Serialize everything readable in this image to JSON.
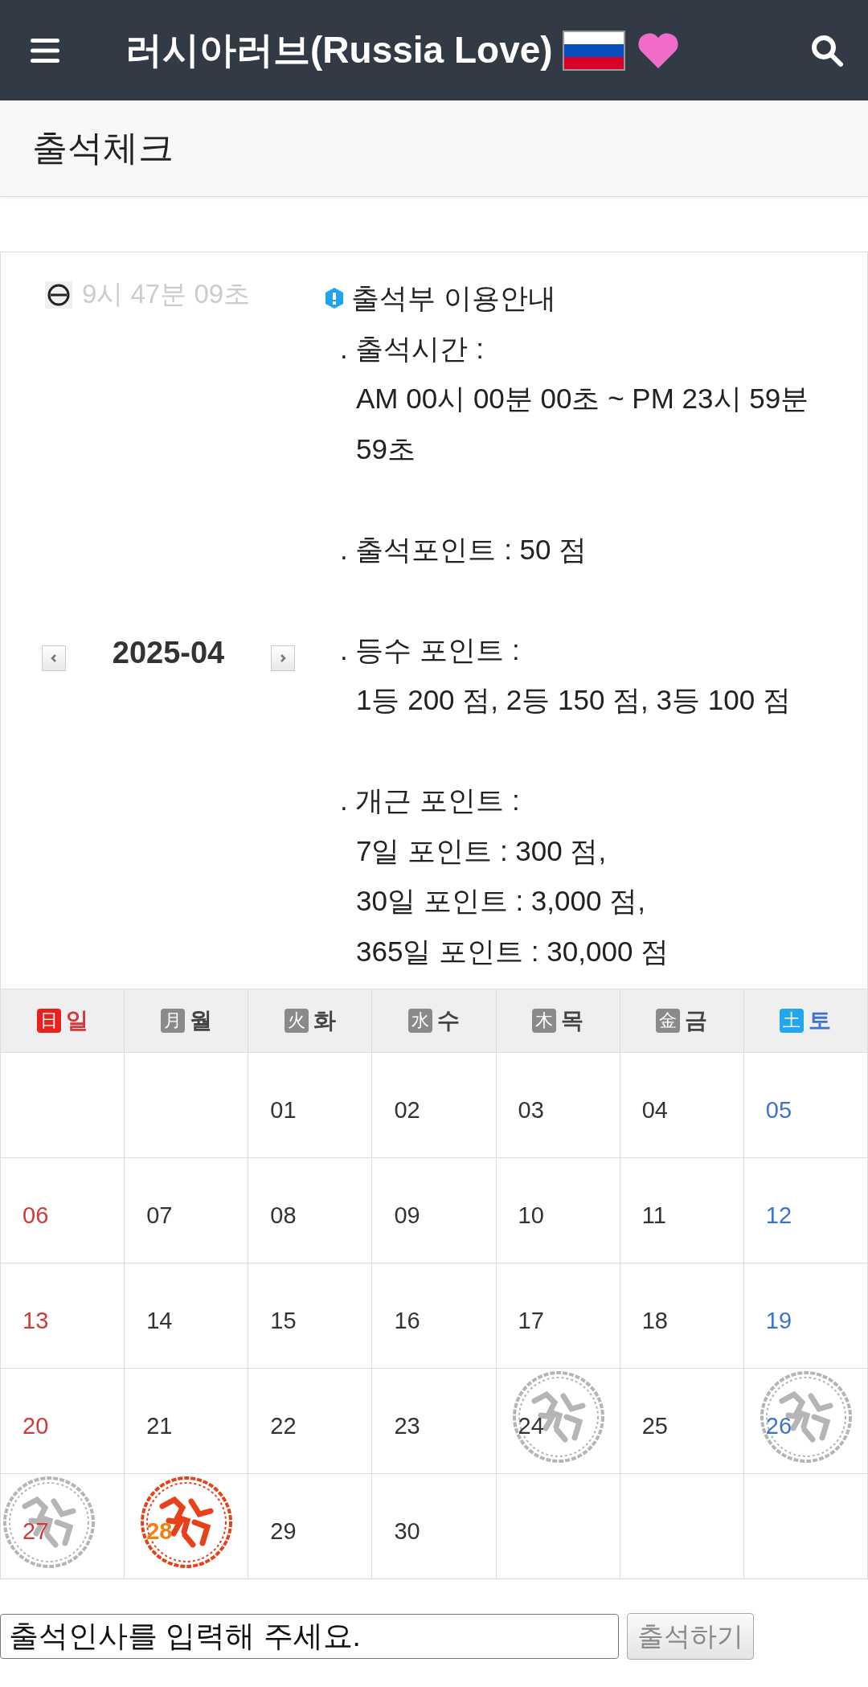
{
  "header": {
    "title": "러시아러브(Russia Love)"
  },
  "page_title": "출석체크",
  "clock": "9시 47분 09초",
  "month": "2025-04",
  "info": {
    "title": "출석부 이용안내",
    "sections": [
      {
        "label": ". 출석시간 :",
        "details": [
          "AM 00시 00분 00초 ~ PM 23시 59분 59초"
        ]
      },
      {
        "label": ". 출석포인트 : 50 점"
      },
      {
        "label": ". 등수 포인트 :",
        "details": [
          "1등 200 점, 2등 150 점, 3등 100 점"
        ]
      },
      {
        "label": ". 개근 포인트 :",
        "details": [
          "7일 포인트 : 300 점,",
          "30일 포인트 : 3,000 점,",
          "365일 포인트 : 30,000 점"
        ]
      }
    ]
  },
  "weekdays": [
    {
      "badge": "日",
      "label": "일",
      "kind": "sunday"
    },
    {
      "badge": "月",
      "label": "월",
      "kind": "weekday"
    },
    {
      "badge": "火",
      "label": "화",
      "kind": "weekday"
    },
    {
      "badge": "水",
      "label": "수",
      "kind": "weekday"
    },
    {
      "badge": "木",
      "label": "목",
      "kind": "weekday"
    },
    {
      "badge": "金",
      "label": "금",
      "kind": "weekday"
    },
    {
      "badge": "土",
      "label": "토",
      "kind": "saturday"
    }
  ],
  "weeks": [
    [
      {
        "kind": "blank"
      },
      {
        "kind": "blank"
      },
      {
        "kind": "day",
        "day": "01",
        "stamped": false,
        "today": false
      },
      {
        "kind": "day",
        "day": "02",
        "stamped": false,
        "today": false
      },
      {
        "kind": "day",
        "day": "03",
        "stamped": false,
        "today": false
      },
      {
        "kind": "day",
        "day": "04",
        "stamped": false,
        "today": false
      },
      {
        "kind": "day",
        "day": "05",
        "stamped": false,
        "today": false
      }
    ],
    [
      {
        "kind": "day",
        "day": "06",
        "stamped": false,
        "today": false
      },
      {
        "kind": "day",
        "day": "07",
        "stamped": false,
        "today": false
      },
      {
        "kind": "day",
        "day": "08",
        "stamped": false,
        "today": false
      },
      {
        "kind": "day",
        "day": "09",
        "stamped": false,
        "today": false
      },
      {
        "kind": "day",
        "day": "10",
        "stamped": false,
        "today": false
      },
      {
        "kind": "day",
        "day": "11",
        "stamped": false,
        "today": false
      },
      {
        "kind": "day",
        "day": "12",
        "stamped": false,
        "today": false
      }
    ],
    [
      {
        "kind": "day",
        "day": "13",
        "stamped": false,
        "today": false
      },
      {
        "kind": "day",
        "day": "14",
        "stamped": false,
        "today": false
      },
      {
        "kind": "day",
        "day": "15",
        "stamped": false,
        "today": false
      },
      {
        "kind": "day",
        "day": "16",
        "stamped": false,
        "today": false
      },
      {
        "kind": "day",
        "day": "17",
        "stamped": false,
        "today": false
      },
      {
        "kind": "day",
        "day": "18",
        "stamped": false,
        "today": false
      },
      {
        "kind": "day",
        "day": "19",
        "stamped": false,
        "today": false
      }
    ],
    [
      {
        "kind": "day",
        "day": "20",
        "stamped": false,
        "today": false
      },
      {
        "kind": "day",
        "day": "21",
        "stamped": false,
        "today": false
      },
      {
        "kind": "day",
        "day": "22",
        "stamped": false,
        "today": false
      },
      {
        "kind": "day",
        "day": "23",
        "stamped": false,
        "today": false
      },
      {
        "kind": "day",
        "day": "24",
        "stamped": true,
        "today": false
      },
      {
        "kind": "day",
        "day": "25",
        "stamped": false,
        "today": false
      },
      {
        "kind": "day",
        "day": "26",
        "stamped": true,
        "today": false
      }
    ],
    [
      {
        "kind": "day",
        "day": "27",
        "stamped": true,
        "today": false
      },
      {
        "kind": "day",
        "day": "28",
        "stamped": true,
        "today": true
      },
      {
        "kind": "day",
        "day": "29",
        "stamped": false,
        "today": false
      },
      {
        "kind": "day",
        "day": "30",
        "stamped": false,
        "today": false
      },
      {
        "kind": "blank"
      },
      {
        "kind": "blank"
      },
      {
        "kind": "blank"
      }
    ]
  ],
  "greeting": {
    "value": "출석인사를 입력해 주세요."
  },
  "submit_button": "출석하기"
}
